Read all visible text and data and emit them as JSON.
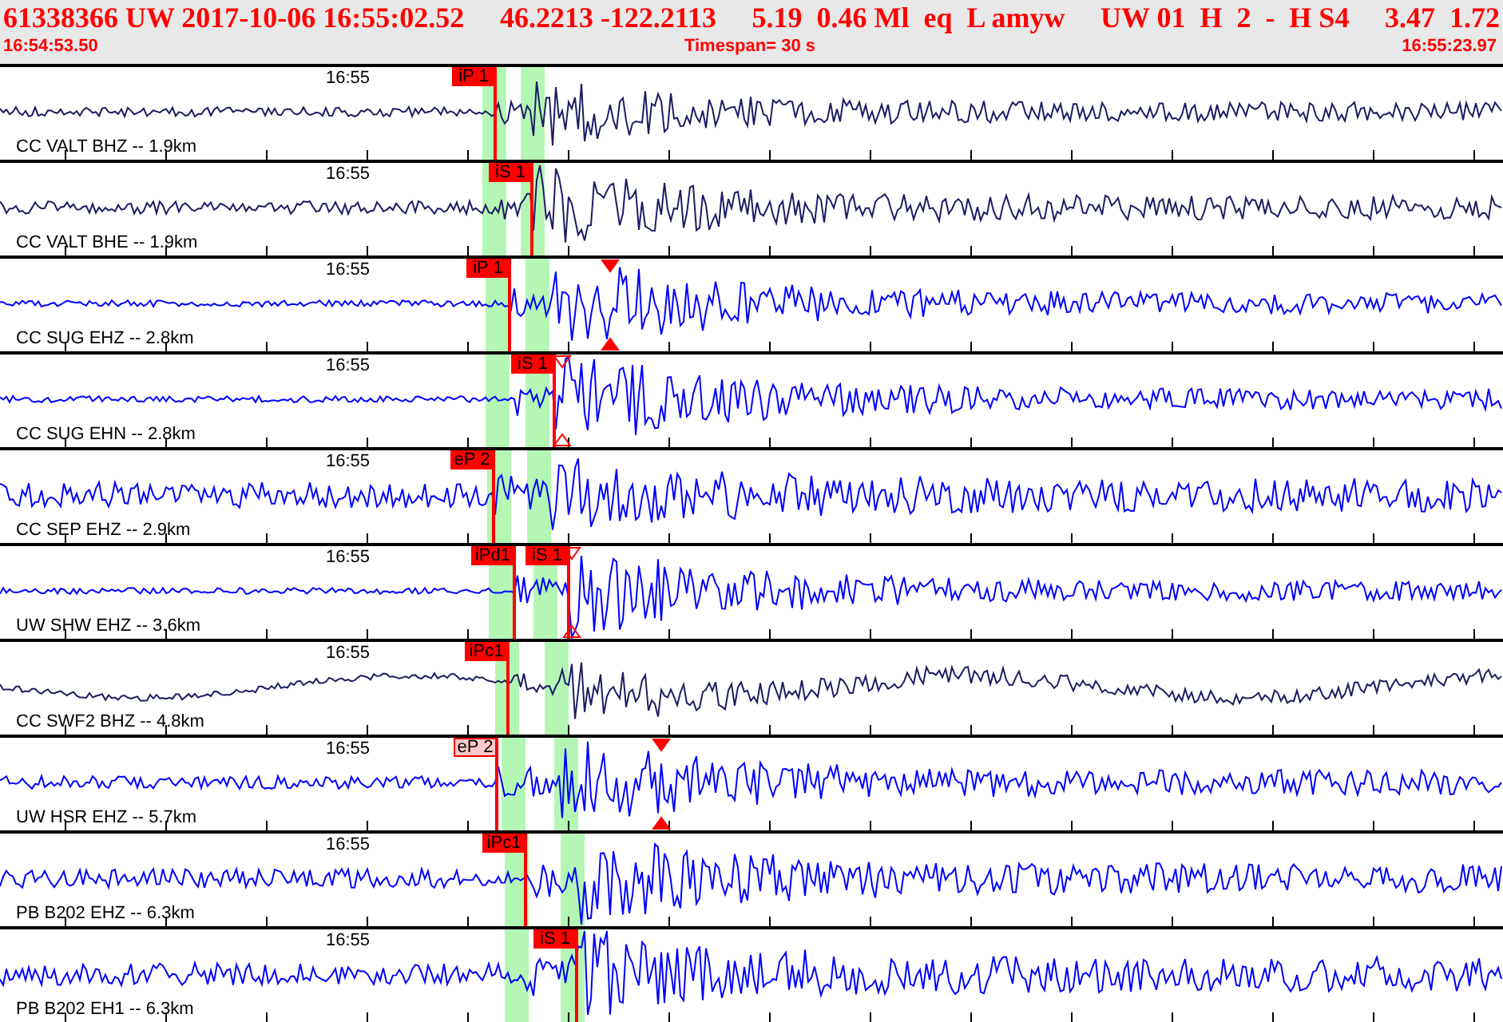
{
  "header": {
    "fields": [
      "61338366 UW 2017-10-06 16:55:02.52",
      "46.2213 -122.2113",
      "5.19  0.46 Ml  eq  L amyw",
      "UW 01  H  2  -  H S4",
      "3.47  1.72"
    ],
    "start_time": "16:54:53.50",
    "timespan": "Timespan=  30 s",
    "end_time": "16:55:23.97"
  },
  "traces": [
    {
      "station": "CC VALT BHZ -- 1.9km",
      "time_label": "16:55",
      "color": "#1c1c64",
      "picks": [
        {
          "label": "iP 1",
          "faded": false
        }
      ]
    },
    {
      "station": "CC VALT BHE -- 1.9km",
      "time_label": "16:55",
      "color": "#1c1c64",
      "picks": [
        {
          "label": "iS 1",
          "faded": false
        }
      ]
    },
    {
      "station": "CC SUG EHZ -- 2.8km",
      "time_label": "16:55",
      "color": "#0000ff",
      "picks": [
        {
          "label": "iP 1",
          "faded": false
        }
      ]
    },
    {
      "station": "CC SUG EHN -- 2.8km",
      "time_label": "16:55",
      "color": "#0000ff",
      "picks": [
        {
          "label": "iS 1",
          "faded": false
        }
      ]
    },
    {
      "station": "CC SEP EHZ -- 2.9km",
      "time_label": "16:55",
      "color": "#0000ff",
      "picks": [
        {
          "label": "eP 2",
          "faded": false
        }
      ]
    },
    {
      "station": "UW SHW EHZ -- 3.6km",
      "time_label": "16:55",
      "color": "#0000ff",
      "picks": [
        {
          "label": "iPd1",
          "faded": false
        },
        {
          "label": "iS 1",
          "faded": false
        }
      ]
    },
    {
      "station": "CC SWF2 BHZ -- 4.8km",
      "time_label": "16:55",
      "color": "#1c1c64",
      "picks": [
        {
          "label": "iPc1",
          "faded": false
        }
      ]
    },
    {
      "station": "UW HSR EHZ -- 5.7km",
      "time_label": "16:55",
      "color": "#0000ff",
      "picks": [
        {
          "label": "eP 2",
          "faded": true
        }
      ]
    },
    {
      "station": "PB B202 EHZ -- 6.3km",
      "time_label": "16:55",
      "color": "#0000ff",
      "picks": [
        {
          "label": "iPc1",
          "faded": false
        }
      ]
    },
    {
      "station": "PB B202 EH1 -- 6.3km",
      "time_label": "16:55",
      "color": "#0000ff",
      "picks": [
        {
          "label": "iS 1",
          "faded": false
        }
      ]
    }
  ]
}
